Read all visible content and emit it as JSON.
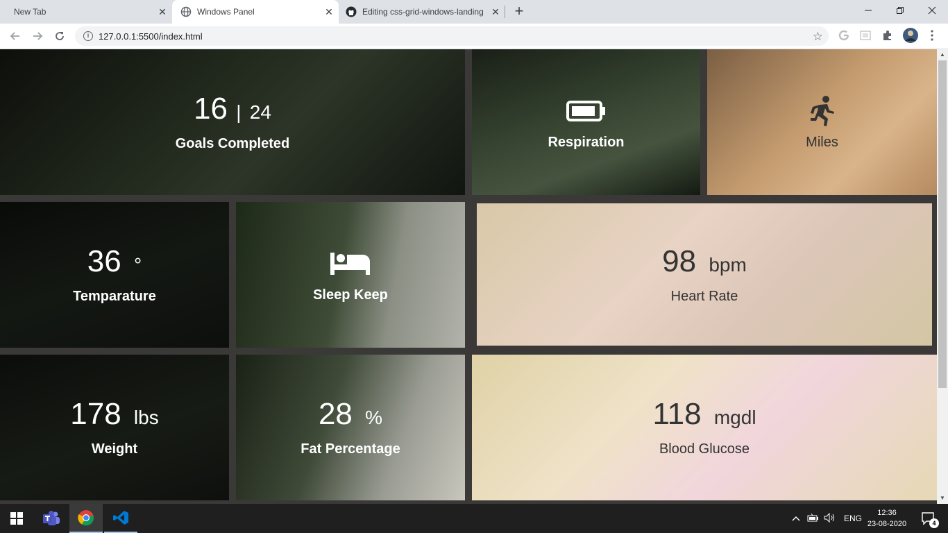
{
  "browser": {
    "tabs": [
      {
        "title": "New Tab"
      },
      {
        "title": "Windows Panel"
      },
      {
        "title": "Editing css-grid-windows-landing"
      }
    ],
    "url": "127.0.0.1:5500/index.html"
  },
  "tiles": {
    "goals": {
      "value": "16",
      "separator": "|",
      "total": "24",
      "label": "Goals Completed"
    },
    "respiration": {
      "icon": "battery-icon",
      "label": "Respiration"
    },
    "miles": {
      "icon": "running-icon",
      "label": "Miles"
    },
    "temperature": {
      "value": "36",
      "unit": "°",
      "label": "Temparature"
    },
    "sleep": {
      "icon": "bed-icon",
      "label": "Sleep Keep"
    },
    "heart": {
      "value": "98",
      "unit": "bpm",
      "label": "Heart Rate"
    },
    "weight": {
      "value": "178",
      "unit": "lbs",
      "label": "Weight"
    },
    "fat": {
      "value": "28",
      "unit": "%",
      "label": "Fat Percentage"
    },
    "glucose": {
      "value": "118",
      "unit": "mgdl",
      "label": "Blood Glucose"
    }
  },
  "taskbar": {
    "apps": [
      "windows-start-icon",
      "teams-icon",
      "chrome-icon",
      "vscode-icon"
    ],
    "language": "ENG",
    "time": "12:36",
    "date": "23-08-2020",
    "notifications": "4"
  }
}
